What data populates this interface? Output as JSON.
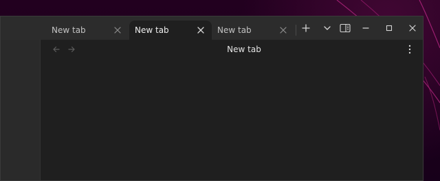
{
  "window": {
    "tabs": [
      {
        "label": "New tab",
        "active": false
      },
      {
        "label": "New tab",
        "active": true
      },
      {
        "label": "New tab",
        "active": false
      }
    ],
    "toolbar_icons": [
      "plus-icon",
      "chevron-down-icon",
      "split-view-icon",
      "minimize-icon",
      "maximize-icon",
      "close-icon"
    ]
  },
  "content": {
    "title": "New tab",
    "back_icon": "arrow-left-icon",
    "forward_icon": "arrow-right-icon",
    "menu_icon": "more-vertical-icon"
  },
  "colors": {
    "desktop_bg": "#1a0018",
    "window_bg": "#2c2c2c",
    "active_tab_bg": "#1f1f1f",
    "content_bg": "#1f1f1f",
    "text_primary": "#e4e4e4",
    "text_secondary": "#c3c3c3",
    "icon_muted": "#5d5d5d"
  }
}
